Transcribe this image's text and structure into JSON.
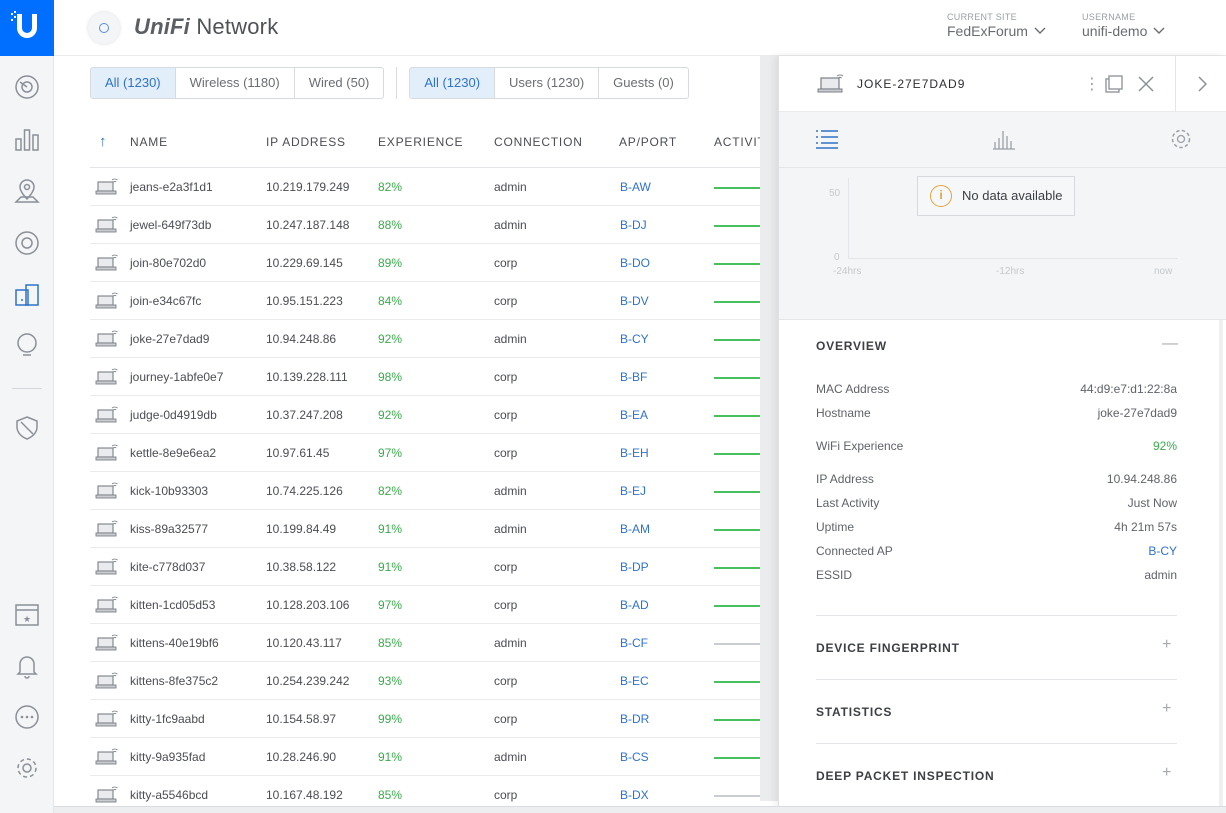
{
  "app": {
    "brand_prefix": "UniFi",
    "brand_suffix": "Network"
  },
  "header": {
    "site_label": "CURRENT SITE",
    "site_value": "FedExForum",
    "user_label": "USERNAME",
    "user_value": "unifi-demo"
  },
  "sidebar": {
    "items": [
      {
        "icon": "dashboard-icon"
      },
      {
        "icon": "statistics-icon"
      },
      {
        "icon": "map-icon"
      },
      {
        "icon": "devices-icon"
      },
      {
        "icon": "clients-icon",
        "active": true
      },
      {
        "icon": "insights-icon"
      },
      {
        "icon": "shield-icon"
      },
      {
        "icon": "events-icon"
      },
      {
        "icon": "alerts-icon"
      },
      {
        "icon": "support-icon"
      },
      {
        "icon": "settings-icon"
      }
    ]
  },
  "filters": {
    "type": [
      {
        "label": "All (1230)",
        "active": true
      },
      {
        "label": "Wireless (1180)"
      },
      {
        "label": "Wired (50)"
      }
    ],
    "group": [
      {
        "label": "All (1230)",
        "active": true
      },
      {
        "label": "Users (1230)"
      },
      {
        "label": "Guests (0)"
      }
    ]
  },
  "table": {
    "sort_arrow": "↑",
    "headers": {
      "name": "NAME",
      "ip": "IP ADDRESS",
      "experience": "EXPERIENCE",
      "connection": "CONNECTION",
      "ap_port": "AP/PORT",
      "activity": "ACTIVITY"
    },
    "rows": [
      {
        "name": "jeans-e2a3f1d1",
        "ip": "10.219.179.249",
        "experience": "82%",
        "connection": "admin",
        "ap": "B-AW",
        "activity_idle": false
      },
      {
        "name": "jewel-649f73db",
        "ip": "10.247.187.148",
        "experience": "88%",
        "connection": "admin",
        "ap": "B-DJ",
        "activity_idle": false
      },
      {
        "name": "join-80e702d0",
        "ip": "10.229.69.145",
        "experience": "89%",
        "connection": "corp",
        "ap": "B-DO",
        "activity_idle": false
      },
      {
        "name": "join-e34c67fc",
        "ip": "10.95.151.223",
        "experience": "84%",
        "connection": "corp",
        "ap": "B-DV",
        "activity_idle": false
      },
      {
        "name": "joke-27e7dad9",
        "ip": "10.94.248.86",
        "experience": "92%",
        "connection": "admin",
        "ap": "B-CY",
        "activity_idle": false
      },
      {
        "name": "journey-1abfe0e7",
        "ip": "10.139.228.111",
        "experience": "98%",
        "connection": "corp",
        "ap": "B-BF",
        "activity_idle": false
      },
      {
        "name": "judge-0d4919db",
        "ip": "10.37.247.208",
        "experience": "92%",
        "connection": "corp",
        "ap": "B-EA",
        "activity_idle": false
      },
      {
        "name": "kettle-8e9e6ea2",
        "ip": "10.97.61.45",
        "experience": "97%",
        "connection": "corp",
        "ap": "B-EH",
        "activity_idle": false
      },
      {
        "name": "kick-10b93303",
        "ip": "10.74.225.126",
        "experience": "82%",
        "connection": "admin",
        "ap": "B-EJ",
        "activity_idle": false
      },
      {
        "name": "kiss-89a32577",
        "ip": "10.199.84.49",
        "experience": "91%",
        "connection": "admin",
        "ap": "B-AM",
        "activity_idle": false
      },
      {
        "name": "kite-c778d037",
        "ip": "10.38.58.122",
        "experience": "91%",
        "connection": "corp",
        "ap": "B-DP",
        "activity_idle": false
      },
      {
        "name": "kitten-1cd05d53",
        "ip": "10.128.203.106",
        "experience": "97%",
        "connection": "corp",
        "ap": "B-AD",
        "activity_idle": false
      },
      {
        "name": "kittens-40e19bf6",
        "ip": "10.120.43.117",
        "experience": "85%",
        "connection": "admin",
        "ap": "B-CF",
        "activity_idle": true
      },
      {
        "name": "kittens-8fe375c2",
        "ip": "10.254.239.242",
        "experience": "93%",
        "connection": "corp",
        "ap": "B-EC",
        "activity_idle": false
      },
      {
        "name": "kitty-1fc9aabd",
        "ip": "10.154.58.97",
        "experience": "99%",
        "connection": "corp",
        "ap": "B-DR",
        "activity_idle": false
      },
      {
        "name": "kitty-9a935fad",
        "ip": "10.28.246.90",
        "experience": "91%",
        "connection": "admin",
        "ap": "B-CS",
        "activity_idle": false
      },
      {
        "name": "kitty-a5546bcd",
        "ip": "10.167.48.192",
        "experience": "85%",
        "connection": "corp",
        "ap": "B-DX",
        "activity_idle": true
      }
    ]
  },
  "panel": {
    "title": "JOKE-27E7DAD9",
    "chart": {
      "no_data": "No data available",
      "y_tick_top": "50",
      "y_tick_bottom": "0",
      "x_ticks": [
        "-24hrs",
        "-12hrs",
        "now"
      ]
    },
    "overview": {
      "title": "OVERVIEW",
      "toggle": "—",
      "fields": [
        {
          "label": "MAC Address",
          "value": "44:d9:e7:d1:22:8a"
        },
        {
          "label": "Hostname",
          "value": "joke-27e7dad9"
        },
        {
          "label": "WiFi Experience",
          "value": "92%",
          "color": "#3aab4c"
        },
        {
          "label": "IP Address",
          "value": "10.94.248.86"
        },
        {
          "label": "Last Activity",
          "value": "Just Now"
        },
        {
          "label": "Uptime",
          "value": "4h 21m 57s"
        },
        {
          "label": "Connected AP",
          "value": "B-CY",
          "color": "#2f73c9"
        },
        {
          "label": "ESSID",
          "value": "admin"
        }
      ]
    },
    "sections": [
      {
        "title": "DEVICE FINGERPRINT",
        "toggle": "+"
      },
      {
        "title": "STATISTICS",
        "toggle": "+"
      },
      {
        "title": "DEEP PACKET INSPECTION",
        "toggle": "+"
      }
    ]
  },
  "colors": {
    "brand_blue": "#006fff",
    "link_blue": "#2f73c9",
    "good_green": "#3aab4c",
    "warn_orange": "#e4a43c"
  }
}
